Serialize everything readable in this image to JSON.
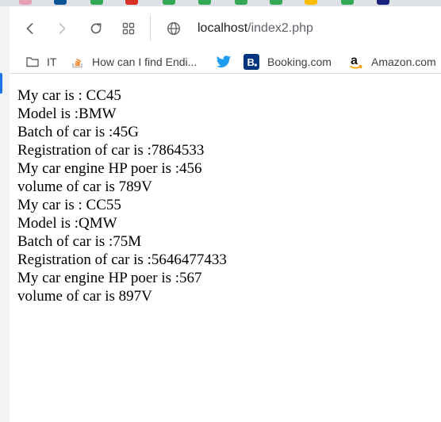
{
  "browser": {
    "url_host": "localhost",
    "url_path": "/index2.php"
  },
  "bookmarks": [
    {
      "label": "IT",
      "icon": "folder-icon"
    },
    {
      "label": "How can I find Endi...",
      "icon": "stackoverflow-icon"
    },
    {
      "label": "",
      "icon": "twitter-icon"
    },
    {
      "label": "Booking.com",
      "icon": "booking-icon"
    },
    {
      "label": "Amazon.com",
      "icon": "amazon-icon"
    }
  ],
  "colors": {
    "link_accent": "#1a73e8",
    "booking_blue": "#003580",
    "twitter_blue": "#1d9bf0",
    "stackoverflow_orange": "#f48024"
  },
  "page": {
    "lines": [
      "My car is : CC45",
      "Model is :BMW",
      "Batch of car is :45G",
      "Registration of car is :7864533",
      "My car engine HP poer is :456",
      "volume of car is 789V",
      "My car is : CC55",
      "Model is :QMW",
      "Batch of car is :75M",
      "Registration of car is :5646477433",
      "My car engine HP poer is :567",
      "volume of car is 897V"
    ]
  }
}
